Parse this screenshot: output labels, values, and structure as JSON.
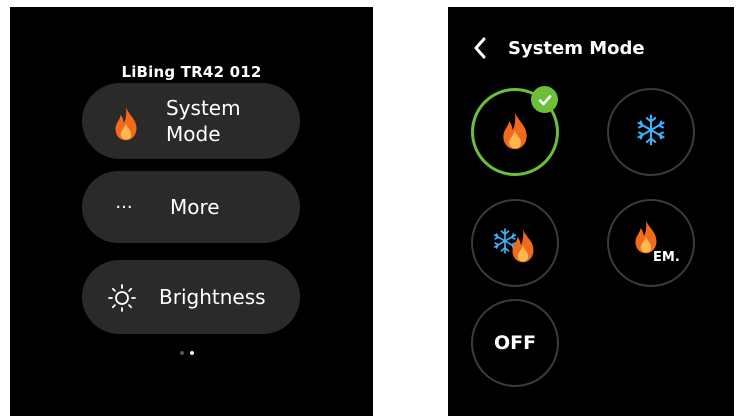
{
  "left_screen": {
    "device_name": "LiBing TR42 012",
    "menu": [
      {
        "label": "System Mode",
        "icon": "flame-icon"
      },
      {
        "label": "More",
        "icon": "ellipsis-icon",
        "icon_glyph": "···"
      },
      {
        "label": "Brightness",
        "icon": "sun-icon"
      }
    ],
    "page_indicator": {
      "count": 2,
      "active_index": 1
    }
  },
  "right_screen": {
    "title": "System Mode",
    "back_icon": "chevron-left-icon",
    "modes": [
      {
        "key": "heat",
        "icon": "flame-icon",
        "selected": true
      },
      {
        "key": "cool",
        "icon": "snowflake-icon",
        "selected": false
      },
      {
        "key": "auto",
        "icon": "snowflake-flame-icon",
        "selected": false
      },
      {
        "key": "em_heat",
        "icon": "flame-icon",
        "label": "EM.",
        "selected": false
      },
      {
        "key": "off",
        "label": "OFF",
        "selected": false
      }
    ]
  },
  "colors": {
    "background": "#000000",
    "pill": "#2a2a2a",
    "selected_ring": "#6bbf3a",
    "flame_outer": "#f26a1b",
    "flame_inner": "#ffb84d",
    "snowflake": "#3ab3ff"
  }
}
